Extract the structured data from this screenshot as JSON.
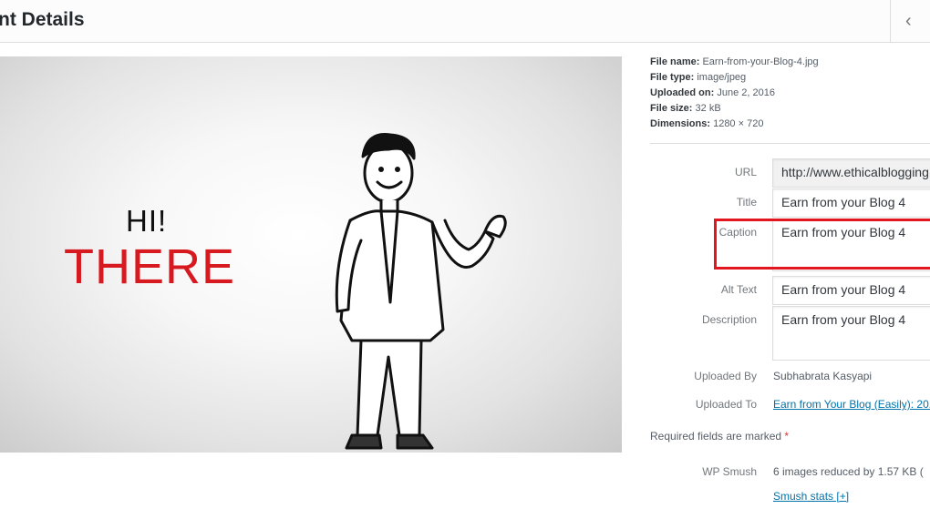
{
  "header": {
    "title": "nt Details",
    "prev_icon": "chevron-left-icon",
    "prev_glyph": "‹"
  },
  "preview": {
    "line1": "HI!",
    "line2": "THERE",
    "accent_color": "#d71920"
  },
  "details": {
    "file_name_label": "File name:",
    "file_name": "Earn-from-your-Blog-4.jpg",
    "file_type_label": "File type:",
    "file_type": "image/jpeg",
    "uploaded_on_label": "Uploaded on:",
    "uploaded_on": "June 2, 2016",
    "file_size_label": "File size:",
    "file_size": "32 kB",
    "dimensions_label": "Dimensions:",
    "dimensions": "1280 × 720"
  },
  "form": {
    "url_label": "URL",
    "url_value": "http://www.ethicalblogging",
    "title_label": "Title",
    "title_value": "Earn from your Blog 4",
    "caption_label": "Caption",
    "caption_value": "Earn from your Blog 4",
    "alt_label": "Alt Text",
    "alt_value": "Earn from your Blog 4",
    "description_label": "Description",
    "description_value": "Earn from your Blog 4",
    "uploaded_by_label": "Uploaded By",
    "uploaded_by_value": "Subhabrata Kasyapi",
    "uploaded_to_label": "Uploaded To",
    "uploaded_to_value": "Earn from Your Blog (Easily): 201",
    "required_text": "Required fields are marked",
    "required_star": "*",
    "smush_label": "WP Smush",
    "smush_value": "6 images reduced by 1.57 KB (",
    "smush_link": "Smush stats [+]"
  }
}
